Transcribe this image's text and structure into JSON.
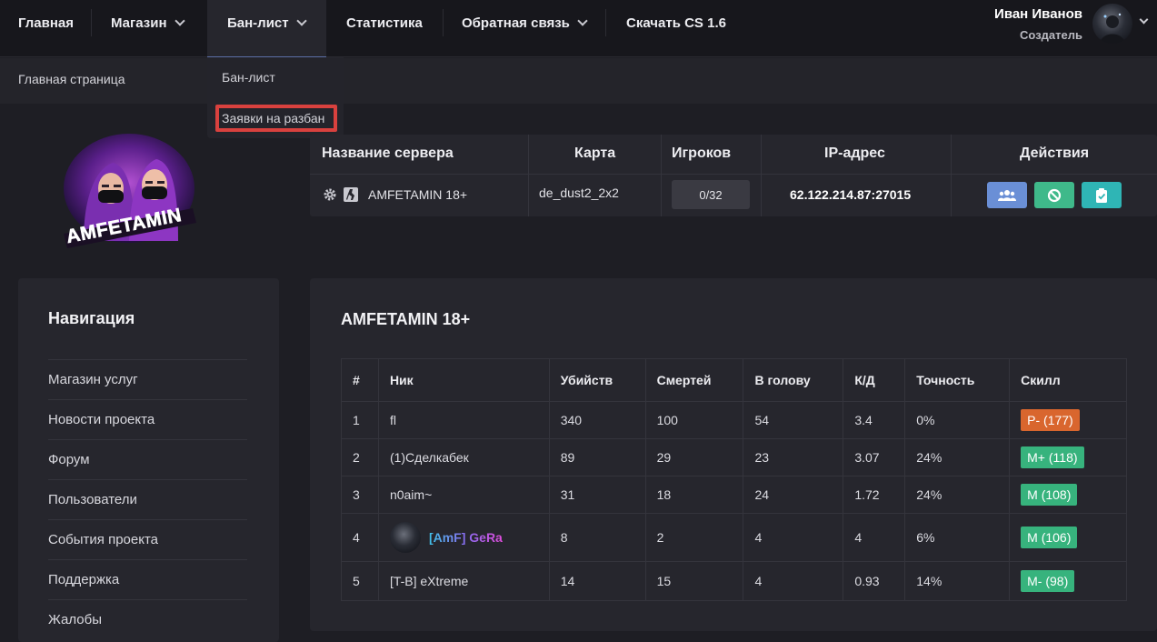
{
  "topnav": {
    "items": [
      {
        "label": "Главная",
        "has_dropdown": false
      },
      {
        "label": "Магазин",
        "has_dropdown": true
      },
      {
        "label": "Бан-лист",
        "has_dropdown": true,
        "active": true
      },
      {
        "label": "Статистика",
        "has_dropdown": false
      },
      {
        "label": "Обратная связь",
        "has_dropdown": true
      },
      {
        "label": "Скачать CS 1.6",
        "has_dropdown": false
      }
    ],
    "user_name": "Иван Иванов",
    "user_role": "Создатель"
  },
  "breadcrumb": "Главная страница",
  "dropdown": {
    "items": [
      "Бан-лист",
      "Заявки на разбан"
    ],
    "highlighted": "Заявки на разбан"
  },
  "logo_text": "AMFETAMIN",
  "server_table": {
    "headers": [
      "Название сервера",
      "Карта",
      "Игроков",
      "IP-адрес",
      "Действия"
    ],
    "row": {
      "name": "AMFETAMIN 18+",
      "map": "de_dust2_2x2",
      "players": "0/32",
      "ip": "62.122.214.87:27015"
    },
    "actions": [
      {
        "icon": "users-icon",
        "color": "#6a8fd6"
      },
      {
        "icon": "ban-icon",
        "color": "#3fb98a"
      },
      {
        "icon": "clipboard-check-icon",
        "color": "#2fb5b5"
      }
    ]
  },
  "sidebar": {
    "title": "Навигация",
    "items": [
      "Магазин услуг",
      "Новости проекта",
      "Форум",
      "Пользователи",
      "События проекта",
      "Поддержка",
      "Жалобы"
    ]
  },
  "stats": {
    "title": "AMFETAMIN 18+",
    "headers": [
      "#",
      "Ник",
      "Убийств",
      "Смертей",
      "В голову",
      "К/Д",
      "Точность",
      "Скилл"
    ],
    "rows": [
      {
        "n": "1",
        "nick": "fl",
        "kills": "340",
        "deaths": "100",
        "hs": "54",
        "kd": "3.4",
        "acc": "0%",
        "skill": "P- (177)",
        "skill_color": "#d9662e"
      },
      {
        "n": "2",
        "nick": "(1)Сделкабек",
        "kills": "89",
        "deaths": "29",
        "hs": "23",
        "kd": "3.07",
        "acc": "24%",
        "skill": "M+ (118)",
        "skill_color": "#37b37d"
      },
      {
        "n": "3",
        "nick": "n0aim~",
        "kills": "31",
        "deaths": "18",
        "hs": "24",
        "kd": "1.72",
        "acc": "24%",
        "skill": "M (108)",
        "skill_color": "#37b37d"
      },
      {
        "n": "4",
        "nick": "[AmF] GeRa",
        "kills": "8",
        "deaths": "2",
        "hs": "4",
        "kd": "4",
        "acc": "6%",
        "skill": "M (106)",
        "skill_color": "#37b37d"
      },
      {
        "n": "5",
        "nick": "[T-B] eXtreme",
        "kills": "14",
        "deaths": "15",
        "hs": "4",
        "kd": "0.93",
        "acc": "14%",
        "skill": "M- (98)",
        "skill_color": "#37b37d"
      }
    ]
  }
}
